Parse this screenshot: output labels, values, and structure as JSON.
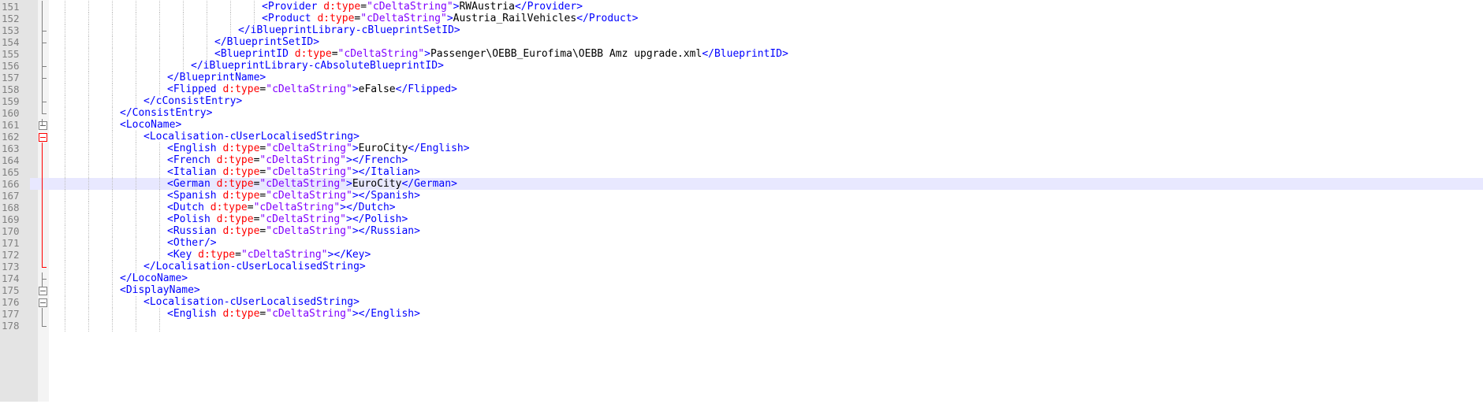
{
  "editor": {
    "lines": [
      {
        "n": "151",
        "indent": 9,
        "tokens": [
          {
            "t": "<Provider ",
            "c": "b"
          },
          {
            "t": "d:type",
            "c": "r"
          },
          {
            "t": "=",
            "c": "k"
          },
          {
            "t": "\"cDeltaString\"",
            "c": "p"
          },
          {
            "t": ">",
            "c": "b"
          },
          {
            "t": "RWAustria",
            "c": "k"
          },
          {
            "t": "</Provider>",
            "c": "b"
          }
        ]
      },
      {
        "n": "152",
        "indent": 9,
        "tokens": [
          {
            "t": "<Product ",
            "c": "b"
          },
          {
            "t": "d:type",
            "c": "r"
          },
          {
            "t": "=",
            "c": "k"
          },
          {
            "t": "\"cDeltaString\"",
            "c": "p"
          },
          {
            "t": ">",
            "c": "b"
          },
          {
            "t": "Austria_RailVehicles",
            "c": "k"
          },
          {
            "t": "</Product>",
            "c": "b"
          }
        ]
      },
      {
        "n": "153",
        "indent": 8,
        "tokens": [
          {
            "t": "</iBlueprintLibrary-cBlueprintSetID>",
            "c": "b"
          }
        ]
      },
      {
        "n": "154",
        "indent": 7,
        "tokens": [
          {
            "t": "</BlueprintSetID>",
            "c": "b"
          }
        ]
      },
      {
        "n": "155",
        "indent": 7,
        "tokens": [
          {
            "t": "<BlueprintID ",
            "c": "b"
          },
          {
            "t": "d:type",
            "c": "r"
          },
          {
            "t": "=",
            "c": "k"
          },
          {
            "t": "\"cDeltaString\"",
            "c": "p"
          },
          {
            "t": ">",
            "c": "b"
          },
          {
            "t": "Passenger\\OEBB_Eurofima\\OEBB Amz upgrade.xml",
            "c": "k"
          },
          {
            "t": "</BlueprintID>",
            "c": "b"
          }
        ]
      },
      {
        "n": "156",
        "indent": 6,
        "tokens": [
          {
            "t": "</iBlueprintLibrary-cAbsoluteBlueprintID>",
            "c": "b"
          }
        ]
      },
      {
        "n": "157",
        "indent": 5,
        "tokens": [
          {
            "t": "</BlueprintName>",
            "c": "b"
          }
        ]
      },
      {
        "n": "158",
        "indent": 5,
        "tokens": [
          {
            "t": "<Flipped ",
            "c": "b"
          },
          {
            "t": "d:type",
            "c": "r"
          },
          {
            "t": "=",
            "c": "k"
          },
          {
            "t": "\"cDeltaString\"",
            "c": "p"
          },
          {
            "t": ">",
            "c": "b"
          },
          {
            "t": "eFalse",
            "c": "k"
          },
          {
            "t": "</Flipped>",
            "c": "b"
          }
        ]
      },
      {
        "n": "159",
        "indent": 4,
        "tokens": [
          {
            "t": "</cConsistEntry>",
            "c": "b"
          }
        ]
      },
      {
        "n": "160",
        "indent": 3,
        "tokens": [
          {
            "t": "</ConsistEntry>",
            "c": "b"
          }
        ]
      },
      {
        "n": "161",
        "indent": 3,
        "tokens": [
          {
            "t": "<LocoName>",
            "c": "b"
          }
        ]
      },
      {
        "n": "162",
        "indent": 4,
        "tokens": [
          {
            "t": "<Localisation-cUserLocalisedString>",
            "c": "b"
          }
        ]
      },
      {
        "n": "163",
        "indent": 5,
        "tokens": [
          {
            "t": "<English ",
            "c": "b"
          },
          {
            "t": "d:type",
            "c": "r"
          },
          {
            "t": "=",
            "c": "k"
          },
          {
            "t": "\"cDeltaString\"",
            "c": "p"
          },
          {
            "t": ">",
            "c": "b"
          },
          {
            "t": "EuroCity",
            "c": "k"
          },
          {
            "t": "</English>",
            "c": "b"
          }
        ]
      },
      {
        "n": "164",
        "indent": 5,
        "tokens": [
          {
            "t": "<French ",
            "c": "b"
          },
          {
            "t": "d:type",
            "c": "r"
          },
          {
            "t": "=",
            "c": "k"
          },
          {
            "t": "\"cDeltaString\"",
            "c": "p"
          },
          {
            "t": "></French>",
            "c": "b"
          }
        ]
      },
      {
        "n": "165",
        "indent": 5,
        "tokens": [
          {
            "t": "<Italian ",
            "c": "b"
          },
          {
            "t": "d:type",
            "c": "r"
          },
          {
            "t": "=",
            "c": "k"
          },
          {
            "t": "\"cDeltaString\"",
            "c": "p"
          },
          {
            "t": "></Italian>",
            "c": "b"
          }
        ]
      },
      {
        "n": "166",
        "indent": 5,
        "current": true,
        "tokens": [
          {
            "t": "<German ",
            "c": "b"
          },
          {
            "t": "d:type",
            "c": "r"
          },
          {
            "t": "=",
            "c": "k"
          },
          {
            "t": "\"cDeltaString\"",
            "c": "p"
          },
          {
            "t": ">",
            "c": "b"
          },
          {
            "t": "EuroCity",
            "c": "k"
          },
          {
            "t": "</German>",
            "c": "b"
          }
        ]
      },
      {
        "n": "167",
        "indent": 5,
        "tokens": [
          {
            "t": "<Spanish ",
            "c": "b"
          },
          {
            "t": "d:type",
            "c": "r"
          },
          {
            "t": "=",
            "c": "k"
          },
          {
            "t": "\"cDeltaString\"",
            "c": "p"
          },
          {
            "t": "></Spanish>",
            "c": "b"
          }
        ]
      },
      {
        "n": "168",
        "indent": 5,
        "tokens": [
          {
            "t": "<Dutch ",
            "c": "b"
          },
          {
            "t": "d:type",
            "c": "r"
          },
          {
            "t": "=",
            "c": "k"
          },
          {
            "t": "\"cDeltaString\"",
            "c": "p"
          },
          {
            "t": "></Dutch>",
            "c": "b"
          }
        ]
      },
      {
        "n": "169",
        "indent": 5,
        "tokens": [
          {
            "t": "<Polish ",
            "c": "b"
          },
          {
            "t": "d:type",
            "c": "r"
          },
          {
            "t": "=",
            "c": "k"
          },
          {
            "t": "\"cDeltaString\"",
            "c": "p"
          },
          {
            "t": "></Polish>",
            "c": "b"
          }
        ]
      },
      {
        "n": "170",
        "indent": 5,
        "tokens": [
          {
            "t": "<Russian ",
            "c": "b"
          },
          {
            "t": "d:type",
            "c": "r"
          },
          {
            "t": "=",
            "c": "k"
          },
          {
            "t": "\"cDeltaString\"",
            "c": "p"
          },
          {
            "t": "></Russian>",
            "c": "b"
          }
        ]
      },
      {
        "n": "171",
        "indent": 5,
        "tokens": [
          {
            "t": "<Other/>",
            "c": "b"
          }
        ]
      },
      {
        "n": "172",
        "indent": 5,
        "tokens": [
          {
            "t": "<Key ",
            "c": "b"
          },
          {
            "t": "d:type",
            "c": "r"
          },
          {
            "t": "=",
            "c": "k"
          },
          {
            "t": "\"cDeltaString\"",
            "c": "p"
          },
          {
            "t": "></Key>",
            "c": "b"
          }
        ]
      },
      {
        "n": "173",
        "indent": 4,
        "tokens": [
          {
            "t": "</Localisation-cUserLocalisedString>",
            "c": "b"
          }
        ]
      },
      {
        "n": "174",
        "indent": 3,
        "tokens": [
          {
            "t": "</LocoName>",
            "c": "b"
          }
        ]
      },
      {
        "n": "175",
        "indent": 3,
        "tokens": [
          {
            "t": "<DisplayName>",
            "c": "b"
          }
        ]
      },
      {
        "n": "176",
        "indent": 4,
        "tokens": [
          {
            "t": "<Localisation-cUserLocalisedString>",
            "c": "b"
          }
        ]
      },
      {
        "n": "177",
        "indent": 5,
        "tokens": [
          {
            "t": "<English ",
            "c": "b"
          },
          {
            "t": "d:type",
            "c": "r"
          },
          {
            "t": "=",
            "c": "k"
          },
          {
            "t": "\"cDeltaString\"",
            "c": "p"
          },
          {
            "t": "></English>",
            "c": "b"
          }
        ]
      },
      {
        "n": "178",
        "indent": 5,
        "tokens": []
      }
    ]
  },
  "colors": {
    "tag": "#0000ff",
    "attribute": "#ff0000",
    "value": "#8000ff",
    "text": "#000000",
    "current_line": "#e8e8ff",
    "fold_active": "#ff0000"
  }
}
